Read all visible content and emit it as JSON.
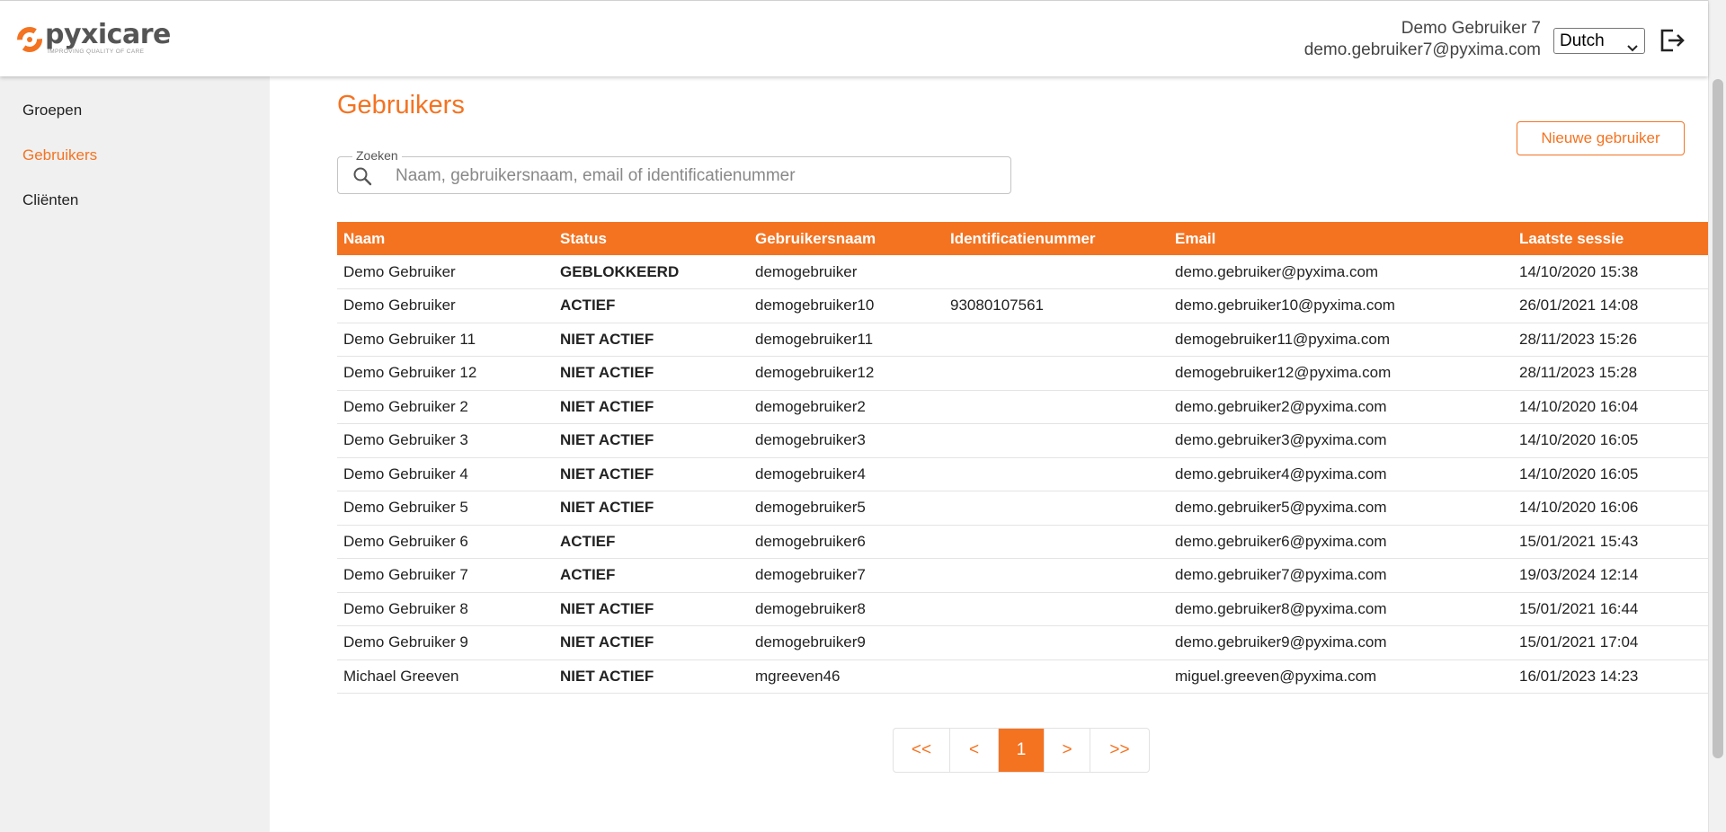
{
  "header": {
    "logo_name": "pyxicare",
    "logo_tagline": "IMPROVING QUALITY OF CARE",
    "user_name": "Demo Gebruiker 7",
    "user_email": "demo.gebruiker7@pyxima.com",
    "language": "Dutch"
  },
  "sidebar": {
    "items": [
      {
        "label": "Groepen"
      },
      {
        "label": "Gebruikers"
      },
      {
        "label": "Cliënten"
      }
    ],
    "active": "Gebruikers"
  },
  "main": {
    "title": "Gebruikers",
    "new_user_label": "Nieuwe gebruiker",
    "search": {
      "legend": "Zoeken",
      "placeholder": "Naam, gebruikersnaam, email of identificatienummer",
      "value": ""
    },
    "table": {
      "columns": [
        "Naam",
        "Status",
        "Gebruikersnaam",
        "Identificatienummer",
        "Email",
        "Laatste sessie"
      ],
      "rows": [
        [
          "Demo Gebruiker",
          "GEBLOKKEERD",
          "demogebruiker",
          "",
          "demo.gebruiker@pyxima.com",
          "14/10/2020 15:38"
        ],
        [
          "Demo Gebruiker",
          "ACTIEF",
          "demogebruiker10",
          "93080107561",
          "demo.gebruiker10@pyxima.com",
          "26/01/2021 14:08"
        ],
        [
          "Demo Gebruiker 11",
          "NIET ACTIEF",
          "demogebruiker11",
          "",
          "demogebruiker11@pyxima.com",
          "28/11/2023 15:26"
        ],
        [
          "Demo Gebruiker 12",
          "NIET ACTIEF",
          "demogebruiker12",
          "",
          "demogebruiker12@pyxima.com",
          "28/11/2023 15:28"
        ],
        [
          "Demo Gebruiker 2",
          "NIET ACTIEF",
          "demogebruiker2",
          "",
          "demo.gebruiker2@pyxima.com",
          "14/10/2020 16:04"
        ],
        [
          "Demo Gebruiker 3",
          "NIET ACTIEF",
          "demogebruiker3",
          "",
          "demo.gebruiker3@pyxima.com",
          "14/10/2020 16:05"
        ],
        [
          "Demo Gebruiker 4",
          "NIET ACTIEF",
          "demogebruiker4",
          "",
          "demo.gebruiker4@pyxima.com",
          "14/10/2020 16:05"
        ],
        [
          "Demo Gebruiker 5",
          "NIET ACTIEF",
          "demogebruiker5",
          "",
          "demo.gebruiker5@pyxima.com",
          "14/10/2020 16:06"
        ],
        [
          "Demo Gebruiker 6",
          "ACTIEF",
          "demogebruiker6",
          "",
          "demo.gebruiker6@pyxima.com",
          "15/01/2021 15:43"
        ],
        [
          "Demo Gebruiker 7",
          "ACTIEF",
          "demogebruiker7",
          "",
          "demo.gebruiker7@pyxima.com",
          "19/03/2024 12:14"
        ],
        [
          "Demo Gebruiker 8",
          "NIET ACTIEF",
          "demogebruiker8",
          "",
          "demo.gebruiker8@pyxima.com",
          "15/01/2021 16:44"
        ],
        [
          "Demo Gebruiker 9",
          "NIET ACTIEF",
          "demogebruiker9",
          "",
          "demo.gebruiker9@pyxima.com",
          "15/01/2021 17:04"
        ],
        [
          "Michael Greeven",
          "NIET ACTIEF",
          "mgreeven46",
          "",
          "miguel.greeven@pyxima.com",
          "16/01/2023 14:23"
        ]
      ]
    },
    "pagination": {
      "first": "<<",
      "prev": "<",
      "current": "1",
      "next": ">",
      "last": ">>"
    }
  },
  "colors": {
    "accent": "#f47321",
    "sidebar_bg": "#f0f0f0"
  },
  "icons": {
    "logo": "pyxicare-logo-icon",
    "language_dropdown": "chevron-down-icon",
    "logout": "logout-icon",
    "search": "search-icon"
  }
}
